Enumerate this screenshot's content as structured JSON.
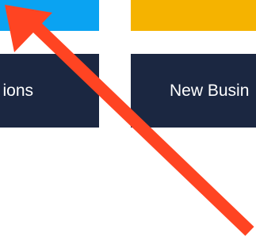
{
  "tiles": {
    "top_left": {
      "color": "#0aa3f2"
    },
    "top_right": {
      "color": "#f5b300"
    },
    "left": {
      "label": "ions"
    },
    "right": {
      "label": "New Busin"
    }
  },
  "annotation": {
    "type": "arrow",
    "color": "#ff4422",
    "icon": "arrow-icon"
  }
}
